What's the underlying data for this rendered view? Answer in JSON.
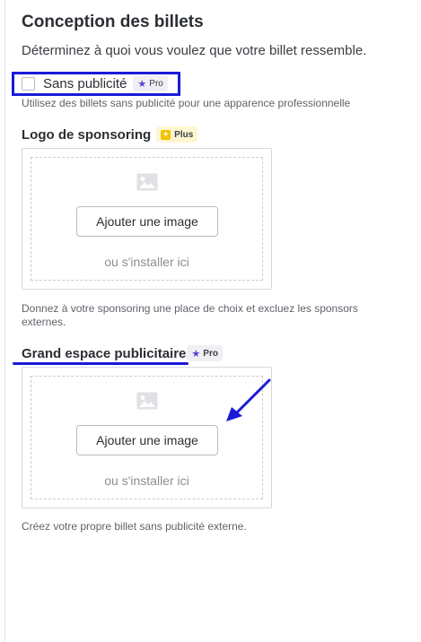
{
  "section": {
    "title": "Conception des billets",
    "subtitle": "Déterminez à quoi vous voulez que votre billet ressemble."
  },
  "ad_free": {
    "label": "Sans publicité",
    "checked": false,
    "badge": "Pro",
    "hint": "Utilisez des billets sans publicité pour une apparence professionnelle"
  },
  "sponsor_logo": {
    "label": "Logo de sponsoring",
    "badge": "Plus",
    "button": "Ajouter une image",
    "drop_text": "ou s'installer ici",
    "hint": "Donnez à votre sponsoring une place de choix et excluez les sponsors externes."
  },
  "large_ad_space": {
    "label": "Grand espace publicitaire",
    "badge": "Pro",
    "button": "Ajouter une image",
    "drop_text": "ou s'installer ici",
    "hint": "Créez votre propre billet sans publicité externe."
  },
  "icons": {
    "pro_badge": "star-icon",
    "plus_badge": "plus-square-icon",
    "upload_placeholder": "image-icon"
  },
  "colors": {
    "pro_star": "#5b3fd6",
    "plus_square": "#f2c200",
    "annotation": "#1a1ad8"
  }
}
